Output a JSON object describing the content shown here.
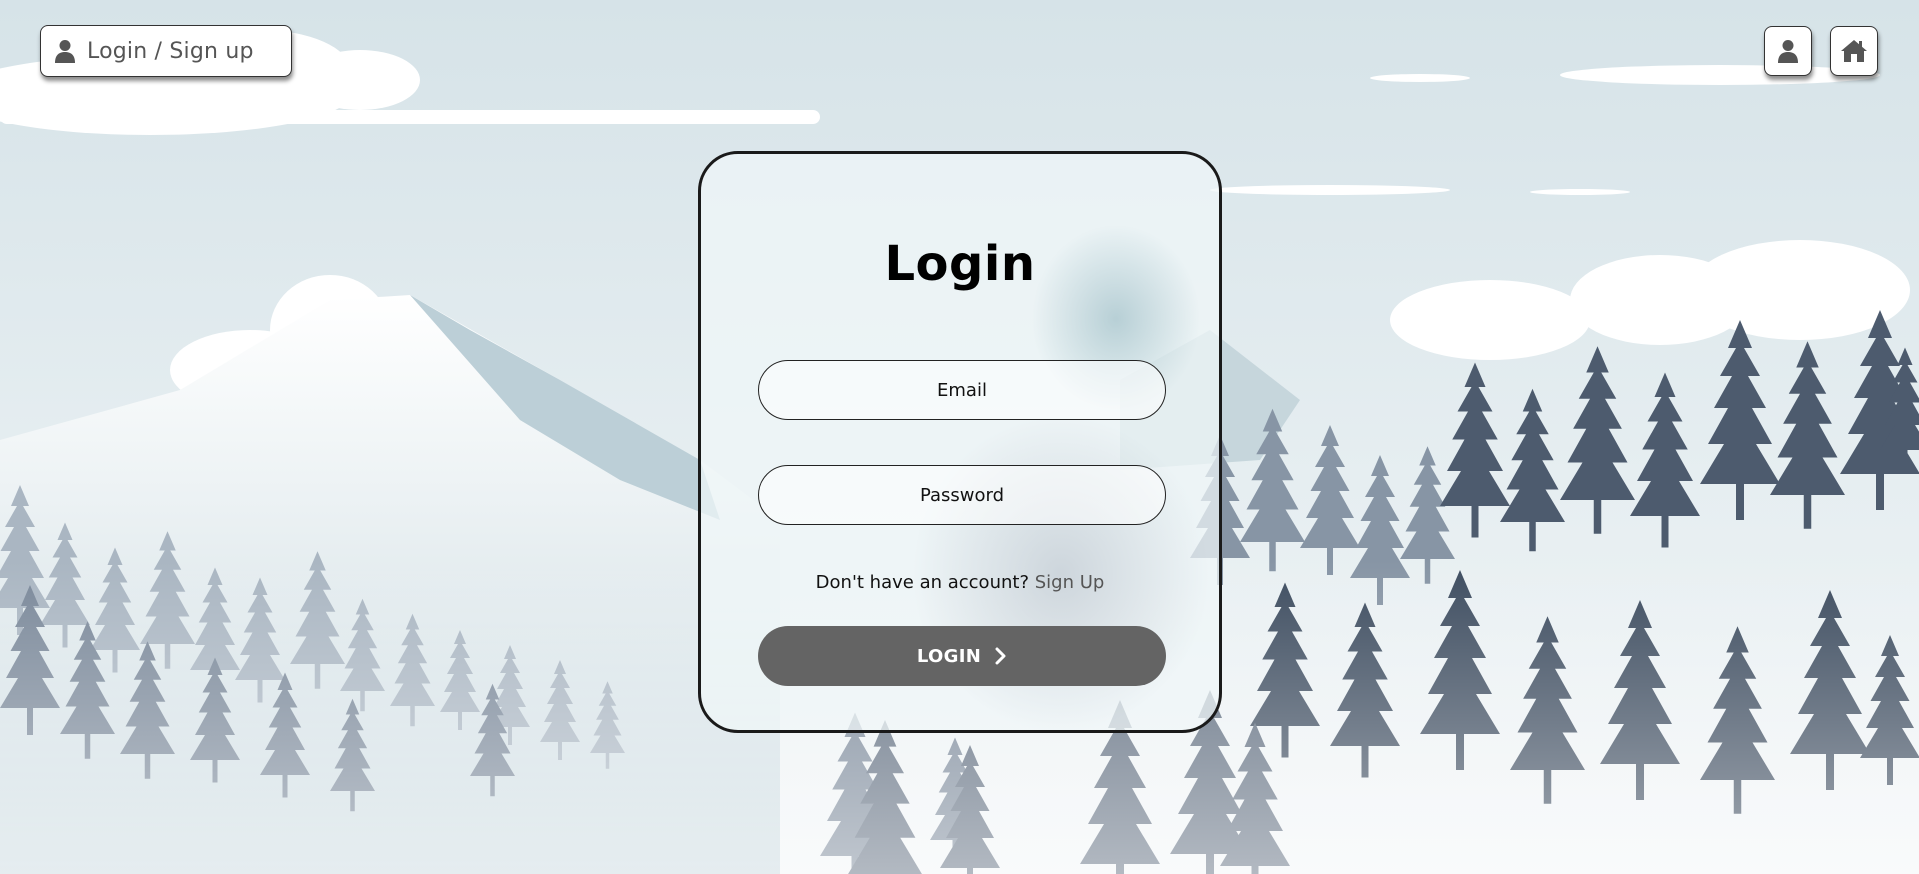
{
  "header": {
    "login_signup_label": "Login / Sign up",
    "profile_icon": "user-icon",
    "home_icon": "home-icon"
  },
  "login_card": {
    "title": "Login",
    "email_placeholder": "Email",
    "password_placeholder": "Password",
    "signup_prompt": "Don't have an account?",
    "signup_link": "Sign Up",
    "login_button_label": "LOGIN",
    "login_button_icon": "chevron-right-icon"
  },
  "colors": {
    "sky": "#d6e3e8",
    "tree_dark": "#3e4d60",
    "button_grey": "#646464",
    "card_border": "#1a1a1a"
  }
}
